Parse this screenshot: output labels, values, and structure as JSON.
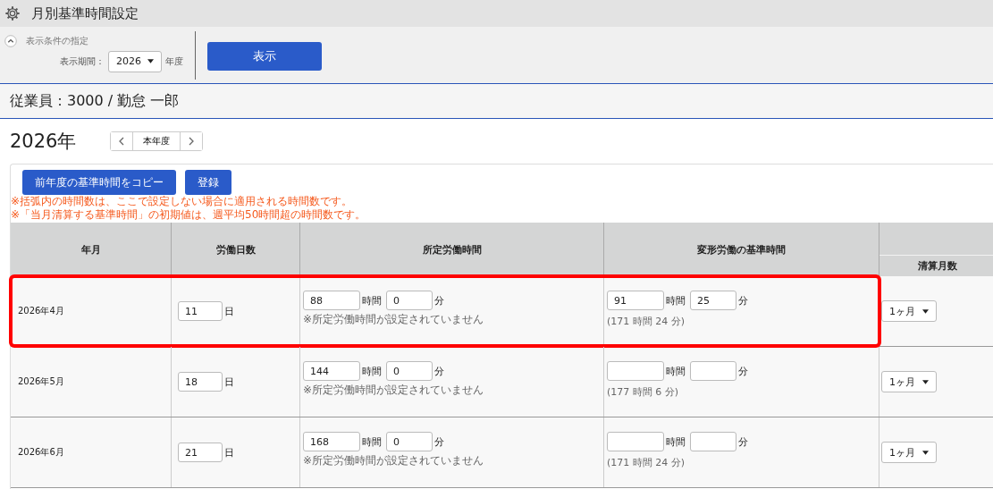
{
  "header": {
    "title": "月別基準時間設定"
  },
  "filter": {
    "section_label": "表示条件の指定",
    "period_label": "表示期間：",
    "year": "2026",
    "year_unit": "年度",
    "show_button": "表示"
  },
  "employee": "従業員：3000 / 勤怠 一郎",
  "year_title": "2026年",
  "nav": {
    "current": "本年度"
  },
  "toolbar": [
    "前年度の基準時間をコピー",
    "登録"
  ],
  "notes": [
    "※括弧内の時間数は、ここで設定しない場合に適用される時間数です。",
    "※「当月清算する基準時間」の初期値は、週平均50時間超の時間数です。"
  ],
  "table": {
    "columns": [
      "年月",
      "労働日数",
      "所定労働時間",
      "変形労働の基準時間"
    ],
    "extra_column": "清算月数",
    "rows": [
      {
        "month": "2026年4月",
        "days": "11",
        "day_unit": "日",
        "hours": "88",
        "hour_unit": "時間",
        "minutes": "0",
        "minute_unit": "分",
        "note": "※所定労働時間が設定されていません",
        "var_hours": "91",
        "var_hour_unit": "時間",
        "var_minutes": "25",
        "var_minute_unit": "分",
        "var_note": "(171 時間 24 分)",
        "settle": "1ヶ月",
        "highlighted": true
      },
      {
        "month": "2026年5月",
        "days": "18",
        "day_unit": "日",
        "hours": "144",
        "hour_unit": "時間",
        "minutes": "0",
        "minute_unit": "分",
        "note": "※所定労働時間が設定されていません",
        "var_hour_unit": "時間",
        "var_minute_unit": "分",
        "var_note": "(177 時間 6 分)",
        "settle": "1ヶ月",
        "highlighted": false
      },
      {
        "month": "2026年6月",
        "days": "21",
        "day_unit": "日",
        "hours": "168",
        "hour_unit": "時間",
        "minutes": "0",
        "minute_unit": "分",
        "note": "※所定労働時間が設定されていません",
        "var_hour_unit": "時間",
        "var_minute_unit": "分",
        "var_note": "(171 時間 24 分)",
        "settle": "1ヶ月",
        "highlighted": false
      }
    ]
  }
}
